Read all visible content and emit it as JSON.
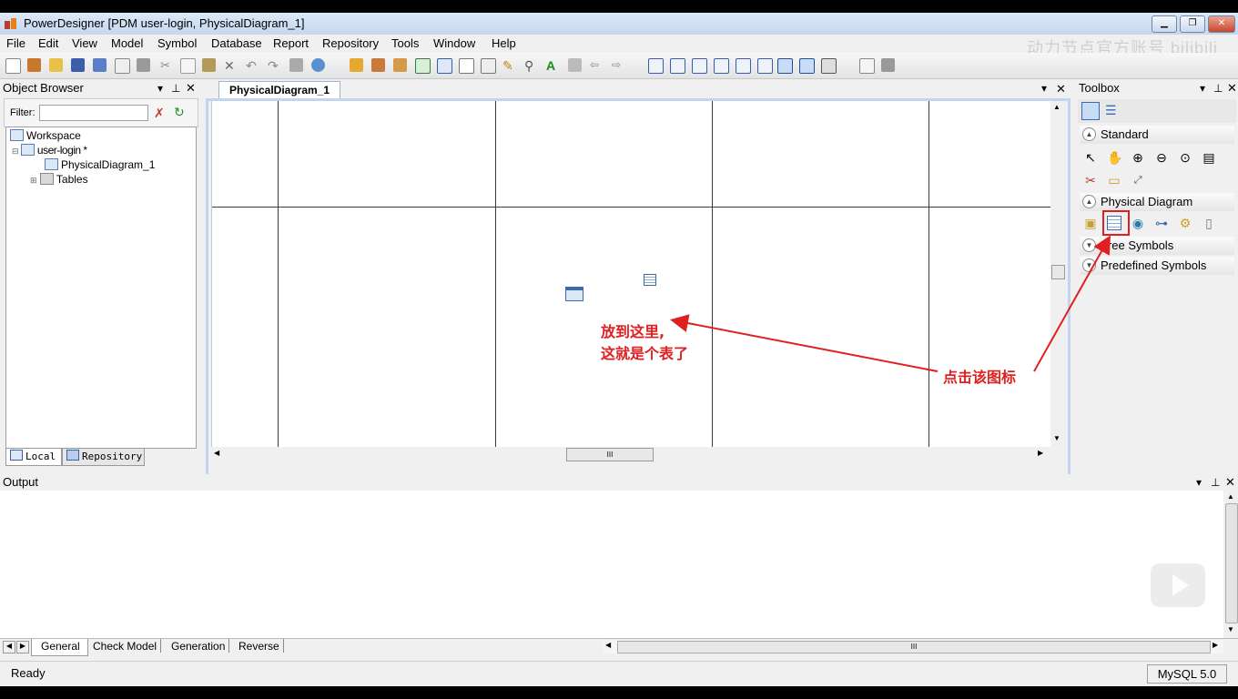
{
  "window": {
    "title": "PowerDesigner [PDM user-login, PhysicalDiagram_1]"
  },
  "watermark": "动力节点官方账号 bilibili",
  "menu": [
    "File",
    "Edit",
    "View",
    "Model",
    "Symbol",
    "Database",
    "Report",
    "Repository",
    "Tools",
    "Window",
    "Help"
  ],
  "object_browser": {
    "title": "Object Browser",
    "filter_label": "Filter:",
    "tree": {
      "workspace": "Workspace",
      "model": "user-login *",
      "diagram": "PhysicalDiagram_1",
      "tables": "Tables"
    },
    "tabs": {
      "local": "Local",
      "repository": "Repository"
    }
  },
  "diagram": {
    "tab_label": "PhysicalDiagram_1",
    "hscroll_grip": "III"
  },
  "toolbox": {
    "title": "Toolbox",
    "sections": {
      "standard": "Standard",
      "physical": "Physical Diagram",
      "free": "Free Symbols",
      "predefined": "Predefined Symbols"
    }
  },
  "output": {
    "title": "Output",
    "tabs": [
      "General",
      "Check Model",
      "Generation",
      "Reverse"
    ],
    "hscroll_grip": "III"
  },
  "status": {
    "left": "Ready",
    "right": "MySQL 5.0"
  },
  "annotations": {
    "drop_line1": "放到这里,",
    "drop_line2": "这就是个表了",
    "click_icon": "点击该图标"
  },
  "colors": {
    "annotation": "#e02020",
    "title_bar": "#c6d8ef"
  }
}
